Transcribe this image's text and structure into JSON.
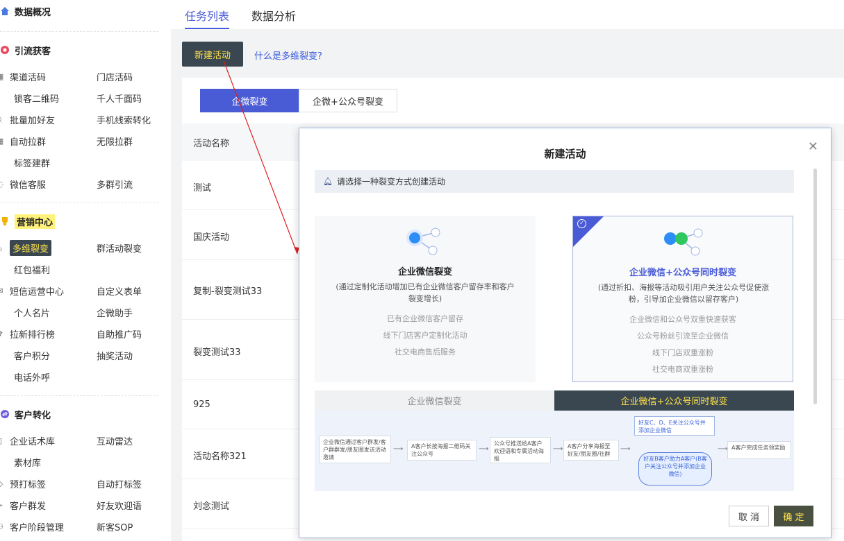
{
  "sidebar": {
    "overview": "数据概况",
    "sections": {
      "traffic": {
        "title": "引流获客",
        "items": [
          "渠道活码",
          "门店活码",
          "锁客二维码",
          "千人千面码",
          "批量加好友",
          "手机线索转化",
          "自动拉群",
          "无限拉群",
          "标签建群",
          "微信客服",
          "多群引流"
        ]
      },
      "marketing": {
        "title": "营销中心",
        "items": [
          "多维裂变",
          "群活动裂变",
          "红包福利",
          "短信运营中心",
          "自定义表单",
          "个人名片",
          "企微助手",
          "拉新排行榜",
          "自助推广码",
          "客户积分",
          "抽奖活动",
          "电话外呼"
        ]
      },
      "convert": {
        "title": "客户转化",
        "items": [
          "企业话术库",
          "互动雷达",
          "素材库",
          "预打标签",
          "自动打标签",
          "客户群发",
          "好友欢迎语",
          "客户阶段管理",
          "新客SOP"
        ]
      }
    }
  },
  "tabs": [
    "任务列表",
    "数据分析"
  ],
  "actions": {
    "new_label": "新建活动",
    "what_link": "什么是多维裂变?"
  },
  "segments": [
    "企微裂变",
    "企微+公众号裂变"
  ],
  "table": {
    "header": "活动名称",
    "rows": [
      "测试",
      "国庆活动",
      "复制-裂变测试33",
      "裂变测试33",
      "925",
      "活动名称321",
      "刘念测试"
    ]
  },
  "modal": {
    "title": "新建活动",
    "notice": "请选择一种裂变方式创建活动",
    "cards": [
      {
        "title": "企业微信裂变",
        "desc": "(通过定制化活动增加已有企业微信客户留存率和客户裂变增长)",
        "features": [
          "已有企业微信客户留存",
          "线下门店客户定制化活动",
          "社交电商售后服务"
        ]
      },
      {
        "title": "企业微信+公众号同时裂变",
        "desc": "(通过折扣、海报等活动吸引用户关注公众号促使涨粉，引导加企业微信以留存客户)",
        "features": [
          "企业微信和公众号双重快速获客",
          "公众号粉丝引流至企业微信",
          "线下门店双重涨粉",
          "社交电商双重涨粉"
        ]
      }
    ],
    "flow_tabs": [
      "企业微信裂变",
      "企业微信+公众号同时裂变"
    ],
    "flow": {
      "step1": "企业微信通过客户群发/客户群群发/朋友圈发送活动邀请",
      "step2": "A客户长按海报二维码关注公众号",
      "step3": "公众号推送给A客户欢迎语和专属活动海报",
      "step4": "A客户分享海报至好友/朋友圈/社群",
      "top": "好友C、D、E关注公众号并添加企业微信",
      "center": "好友B客户助力A客户(B客户关注公众号并添加企业微信)",
      "end": "A客户完成任务领奖励"
    },
    "cancel": "取 消",
    "ok": "确 定"
  },
  "colors": {
    "accent": "#4a5bd6",
    "dark": "#3a4750",
    "yellow": "#ffe34d"
  }
}
